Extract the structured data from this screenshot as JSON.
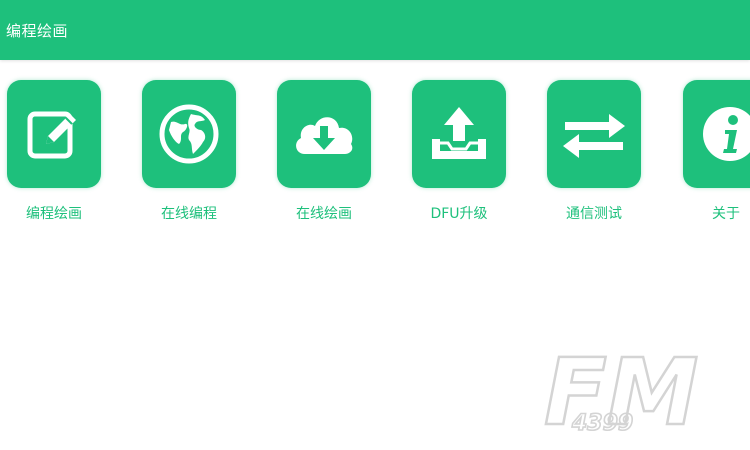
{
  "appbar": {
    "title": "编程绘画"
  },
  "tiles": [
    {
      "label": "编程绘画",
      "icon": "edit-pencil-icon"
    },
    {
      "label": "在线编程",
      "icon": "globe-icon"
    },
    {
      "label": "在线绘画",
      "icon": "cloud-download-icon"
    },
    {
      "label": "DFU升级",
      "icon": "upload-tray-icon"
    },
    {
      "label": "通信测试",
      "icon": "swap-arrows-icon"
    },
    {
      "label": "关于",
      "icon": "info-icon"
    }
  ],
  "watermark": {
    "brand": "FM",
    "number": "4399"
  },
  "colors": {
    "primary": "#1ec07c",
    "text_on_primary": "#ffffff",
    "background": "#ffffff"
  }
}
